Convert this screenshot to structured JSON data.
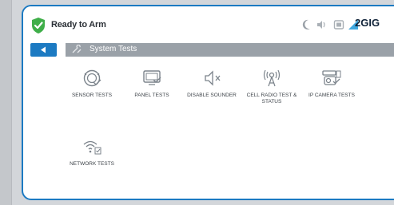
{
  "status": {
    "label": "Ready to Arm",
    "brand": "2GIG"
  },
  "header": {
    "title": "System Tests"
  },
  "tiles": [
    {
      "label": "SENSOR TESTS",
      "icon": "sensor-test-icon"
    },
    {
      "label": "PANEL TESTS",
      "icon": "panel-test-icon"
    },
    {
      "label": "DISABLE SOUNDER",
      "icon": "speaker-mute-icon"
    },
    {
      "label": "CELL RADIO TEST & STATUS",
      "icon": "cell-radio-icon"
    },
    {
      "label": "IP CAMERA TESTS",
      "icon": "ip-camera-icon"
    },
    {
      "label": "NETWORK TESTS",
      "icon": "network-icon"
    }
  ],
  "colors": {
    "accent": "#1c7ac2",
    "ready_green": "#3fae49",
    "icon_gray": "#7b838b",
    "breadcrumb_bg": "#9aa1a8"
  }
}
